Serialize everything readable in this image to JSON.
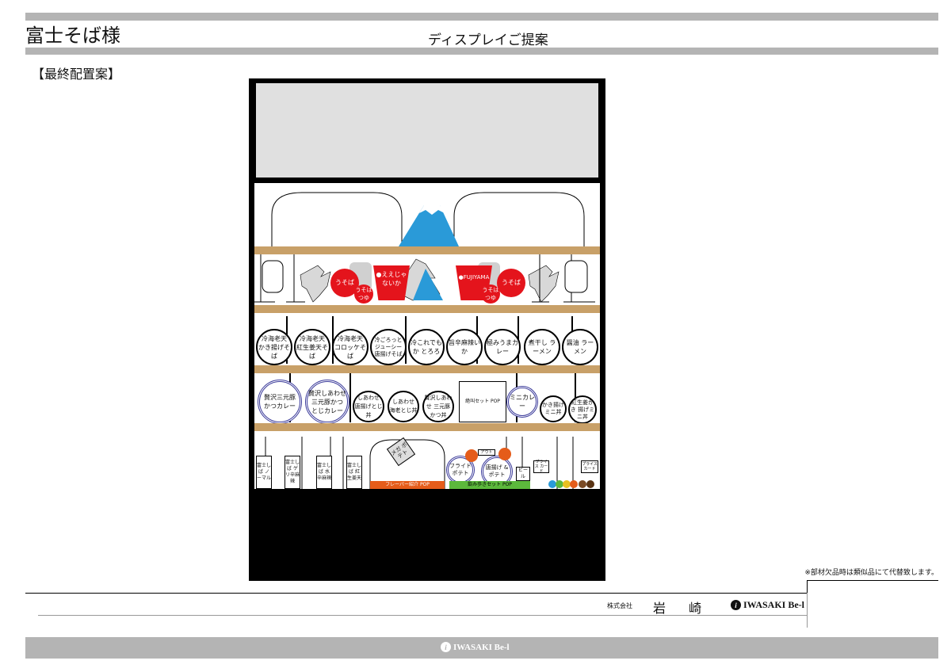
{
  "header": {
    "client": "富士そば様",
    "doc_title": "ディスプレイご提案",
    "section": "【最終配置案】"
  },
  "display": {
    "tier2": [
      {
        "label": "うそば"
      },
      {
        "label": "うそば つゆ"
      },
      {
        "label": "●ええじゃないか"
      },
      {
        "label": "●FUJIYAMA"
      },
      {
        "label": "うそば つゆ"
      },
      {
        "label": "うそば"
      }
    ],
    "tier3": [
      {
        "label": "冷海老天 かき揚げそば"
      },
      {
        "label": "冷海老天 紅生姜天そば"
      },
      {
        "label": "冷海老天 コロッケそば"
      },
      {
        "label": "冷ごろっと ジューシー 唐揚げそば"
      },
      {
        "label": "冷これでもか とろろ"
      },
      {
        "label": "旨辛麻辣いか"
      },
      {
        "label": "極みうまカレー"
      },
      {
        "label": "煮干し ラーメン"
      },
      {
        "label": "醤油 ラーメン"
      }
    ],
    "tier4": [
      {
        "label": "贅沢三元豚 かつカレー"
      },
      {
        "label": "贅沢しあわせ 三元豚かつ とじカレー"
      },
      {
        "label": "しあわせ 唐揚げとじ丼"
      },
      {
        "label": "しあわせ 海老とじ丼"
      },
      {
        "label": "贅沢しあわせ 三元豚かつ丼"
      },
      {
        "label": "ミニカレー"
      },
      {
        "label": "かき揚げ ミニ丼"
      },
      {
        "label": "紅生姜かき 揚げミニ丼"
      }
    ],
    "pop_set": "絶叫セット POP",
    "tier5": {
      "cards": [
        {
          "label": "富士しば ノーマル"
        },
        {
          "label": "富士しば ゲリ辛麻辣"
        },
        {
          "label": "富士しば 水辛麻辣"
        },
        {
          "label": "富士しば 紅生姜天"
        }
      ],
      "mega": "メガ ポテト",
      "flavor_pop": "フレーバー紹介 POP",
      "fried": "フライド ポテト",
      "karaage": "唐揚げ & ポテト",
      "out": "アウト",
      "beer": "ビール",
      "price1": "プライス カード",
      "price2": "プライス カード",
      "nomi_pop": "飲み歩きセット POP"
    }
  },
  "footer": {
    "note": "※部材欠品時は類似品にて代替致します。",
    "company_type": "株式会社",
    "company": "岩 崎",
    "brand": "IWASAKI Be-l",
    "logo_letter": "i",
    "bottom_brand": "IWASAKI Be-l"
  },
  "colors": {
    "accent_red": "#e4141c",
    "fuji_blue": "#2a9ad8",
    "shelf": "#c8a068",
    "bar": "#b4b4b4"
  }
}
